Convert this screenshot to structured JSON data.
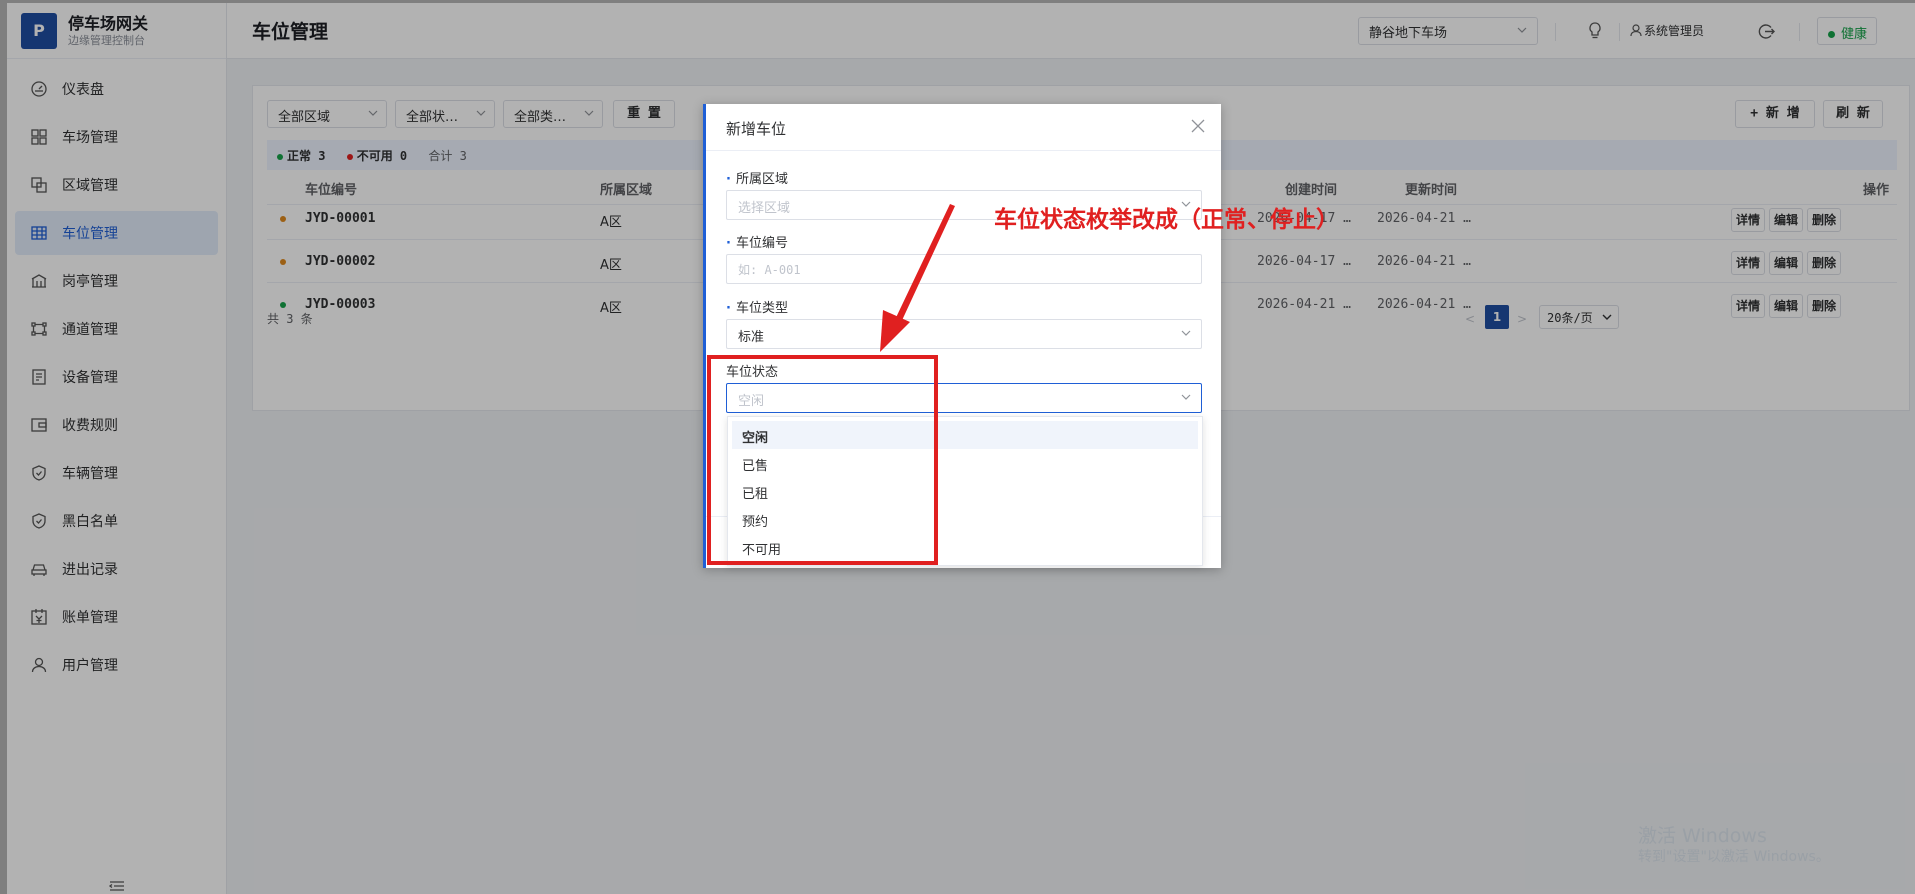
{
  "sidebar": {
    "logo_letter": "P",
    "title": "停车场网关",
    "subtitle": "边缘管理控制台",
    "items": [
      {
        "label": "仪表盘",
        "icon": "dashboard-icon"
      },
      {
        "label": "车场管理",
        "icon": "grid-icon"
      },
      {
        "label": "区域管理",
        "icon": "area-icon"
      },
      {
        "label": "车位管理",
        "icon": "table-icon",
        "active": true
      },
      {
        "label": "岗亭管理",
        "icon": "booth-icon"
      },
      {
        "label": "通道管理",
        "icon": "gate-icon"
      },
      {
        "label": "设备管理",
        "icon": "device-icon"
      },
      {
        "label": "收费规则",
        "icon": "wallet-icon"
      },
      {
        "label": "车辆管理",
        "icon": "shield-icon"
      },
      {
        "label": "黑白名单",
        "icon": "shield-check-icon"
      },
      {
        "label": "进出记录",
        "icon": "car-icon"
      },
      {
        "label": "账单管理",
        "icon": "bill-icon"
      },
      {
        "label": "用户管理",
        "icon": "user-icon"
      }
    ]
  },
  "header": {
    "page_title": "车位管理",
    "lot_selected": "静谷地下车场",
    "user_name": "系统管理员",
    "health_label": "健康"
  },
  "filters": {
    "area": "全部区域",
    "status": "全部状…",
    "type": "全部类…",
    "reset_label": "重 置",
    "add_label": "+ 新 增",
    "refresh_label": "刷 新"
  },
  "summary": {
    "normal": "正常 3",
    "unavailable": "不可用 0",
    "total": "合计 3"
  },
  "table": {
    "columns": {
      "code": "车位编号",
      "area": "所属区域",
      "created": "创建时间",
      "updated": "更新时间",
      "actions": "操作"
    },
    "rows": [
      {
        "code": "JYD-00001",
        "area": "A区",
        "created": "2026-04-17 …",
        "updated": "2026-04-21 …",
        "dot": "#e08a1e"
      },
      {
        "code": "JYD-00002",
        "area": "A区",
        "created": "2026-04-17 …",
        "updated": "2026-04-21 …",
        "dot": "#e08a1e"
      },
      {
        "code": "JYD-00003",
        "area": "A区",
        "created": "2026-04-21 …",
        "updated": "2026-04-21 …",
        "dot": "#16a34a"
      }
    ],
    "action_labels": {
      "detail": "详情",
      "edit": "编辑",
      "delete": "删除"
    }
  },
  "pagination": {
    "total_text": "共 3 条",
    "current_page": "1",
    "prev": "<",
    "next": ">",
    "page_size": "20条/页"
  },
  "dialog": {
    "title": "新增车位",
    "fields": {
      "area_label": "所属区域",
      "area_placeholder": "选择区域",
      "code_label": "车位编号",
      "code_placeholder": "如: A-001",
      "type_label": "车位类型",
      "type_value": "标准",
      "status_label": "车位状态",
      "status_placeholder": "空闲"
    },
    "status_options": [
      "空闲",
      "已售",
      "已租",
      "预约",
      "不可用"
    ]
  },
  "annotation": {
    "text": "车位状态枚举改成（正常、停止）"
  },
  "watermark": {
    "line1": "激活 Windows",
    "line2": "转到\"设置\"以激活 Windows。"
  },
  "colors": {
    "primary": "#1f4ea3",
    "accent": "#1f5fd6",
    "annotation_red": "#e02020",
    "health_green": "#16a34a"
  }
}
